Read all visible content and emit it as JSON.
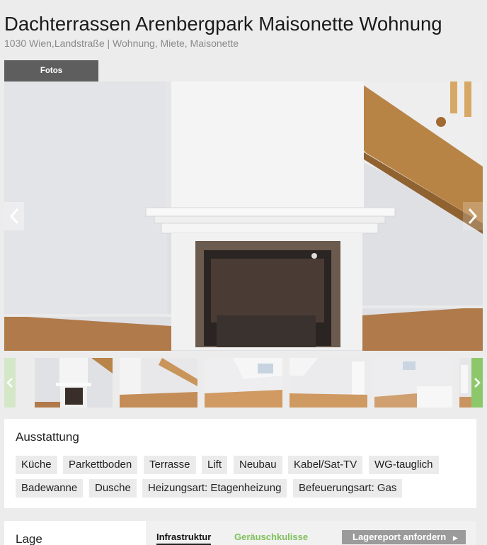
{
  "listing": {
    "title": "Dachterrassen Arenbergpark Maisonette Wohnung",
    "subtitle": "1030 Wien,Landstraße | Wohnung, Miete, Maisonette"
  },
  "gallery": {
    "tab_label": "Fotos",
    "prev_icon": "chevron-left-icon",
    "next_icon": "chevron-right-icon",
    "thumbnail_count_visible": 6
  },
  "ausstattung": {
    "heading": "Ausstattung",
    "tags": [
      "Küche",
      "Parkettboden",
      "Terrasse",
      "Lift",
      "Neubau",
      "Kabel/Sat-TV",
      "WG-tauglich",
      "Badewanne",
      "Dusche",
      "Heizungsart: Etagenheizung",
      "Befeuerungsart: Gas"
    ]
  },
  "lage": {
    "heading": "Lage",
    "tabs": [
      "Infrastruktur",
      "Geräuschkulisse"
    ],
    "report_button": "Lagereport anfordern"
  },
  "colors": {
    "accent_green": "#8cc86a",
    "tab_dark": "#5e5e5e",
    "button_grey": "#9b9b9b"
  }
}
